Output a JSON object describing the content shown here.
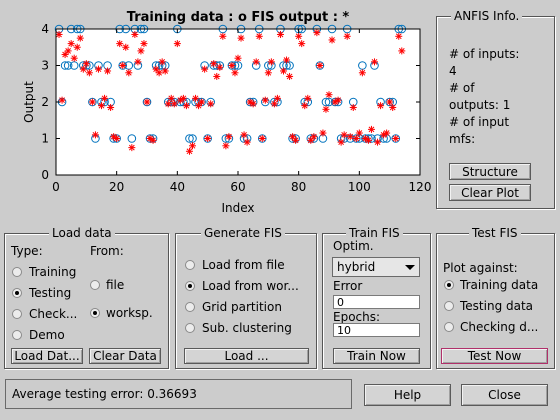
{
  "chart_data": {
    "type": "scatter",
    "title": "Training data : o    FIS output : *",
    "xlabel": "Index",
    "ylabel": "Output",
    "xlim": [
      0,
      120
    ],
    "ylim": [
      0,
      4
    ],
    "xticks": [
      "0",
      "20",
      "40",
      "60",
      "80",
      "100",
      "120"
    ],
    "yticks": [
      "0",
      "1",
      "2",
      "3",
      "4"
    ],
    "grid": false,
    "colors": {
      "training": "#0072bd",
      "fis": "#ff0000"
    },
    "series": [
      {
        "marker": "o",
        "x": [
          1,
          2,
          3,
          4,
          5,
          6,
          7,
          8,
          9,
          10,
          11,
          12,
          13,
          14,
          15,
          16,
          17,
          18,
          19,
          20,
          21,
          22,
          23,
          24,
          25,
          26,
          27,
          28,
          29,
          30,
          31,
          32,
          33,
          34,
          35,
          36,
          37,
          38,
          39,
          40,
          41,
          42,
          43,
          44,
          45,
          46,
          47,
          48,
          49,
          50,
          51,
          52,
          53,
          54,
          55,
          56,
          57,
          58,
          59,
          60,
          61,
          62,
          63,
          64,
          65,
          66,
          67,
          68,
          69,
          70,
          71,
          72,
          73,
          74,
          75,
          76,
          77,
          78,
          79,
          80,
          81,
          82,
          83,
          84,
          85,
          86,
          87,
          88,
          89,
          90,
          91,
          92,
          93,
          94,
          95,
          96,
          97,
          98,
          99,
          100,
          101,
          102,
          103,
          104,
          105,
          106,
          107,
          108,
          109,
          110,
          111,
          112,
          113,
          114
        ],
        "y": [
          4,
          2,
          3,
          3,
          4,
          3,
          4,
          4,
          3,
          3,
          3,
          2,
          1,
          3,
          2,
          2,
          3,
          2,
          1,
          1,
          4,
          3,
          4,
          3,
          1,
          4,
          3,
          4,
          4,
          2,
          1,
          1,
          3,
          3,
          3,
          3,
          2,
          2,
          2,
          4,
          2,
          2,
          2,
          1,
          1,
          2,
          2,
          2,
          3,
          1,
          2,
          3,
          3,
          3,
          4,
          1,
          1,
          3,
          3,
          3,
          4,
          1,
          1,
          2,
          2,
          3,
          4,
          1,
          2,
          3,
          3,
          2,
          2,
          4,
          3,
          3,
          3,
          1,
          1,
          4,
          4,
          2,
          2,
          1,
          1,
          4,
          3,
          1,
          2,
          2,
          4,
          2,
          2,
          1,
          1,
          4,
          1,
          2,
          1,
          1,
          3,
          1,
          1,
          1,
          3,
          1,
          2,
          1,
          1,
          2,
          2,
          1,
          4,
          4
        ]
      },
      {
        "marker": "*",
        "x": [
          1,
          2,
          3,
          4,
          5,
          6,
          7,
          8,
          9,
          10,
          11,
          12,
          13,
          14,
          15,
          16,
          17,
          18,
          19,
          20,
          21,
          22,
          23,
          24,
          25,
          26,
          27,
          28,
          29,
          30,
          31,
          32,
          33,
          34,
          35,
          36,
          37,
          38,
          39,
          40,
          41,
          42,
          43,
          44,
          45,
          46,
          47,
          48,
          49,
          50,
          51,
          52,
          53,
          54,
          55,
          56,
          57,
          58,
          59,
          60,
          61,
          62,
          63,
          64,
          65,
          66,
          67,
          68,
          69,
          70,
          71,
          72,
          73,
          74,
          75,
          76,
          77,
          78,
          79,
          80,
          81,
          82,
          83,
          84,
          85,
          86,
          87,
          88,
          89,
          90,
          91,
          92,
          93,
          94,
          95,
          96,
          97,
          98,
          99,
          100,
          101,
          102,
          103,
          104,
          105,
          106,
          107,
          108,
          109,
          110,
          111,
          112,
          113,
          114
        ],
        "y": [
          3.85,
          2.05,
          3.3,
          3.4,
          3.6,
          3.2,
          3.5,
          3.75,
          2.9,
          3.05,
          2.8,
          2.0,
          1.1,
          2.9,
          1.9,
          2.1,
          2.85,
          1.85,
          1.05,
          1.0,
          3.6,
          3.0,
          3.5,
          2.8,
          0.75,
          3.85,
          3.1,
          3.4,
          3.6,
          2.0,
          1.0,
          0.95,
          2.9,
          2.8,
          3.1,
          2.85,
          1.95,
          2.1,
          1.95,
          3.6,
          2.05,
          2.1,
          1.9,
          0.65,
          0.8,
          2.1,
          1.9,
          2.0,
          2.9,
          1.0,
          1.95,
          3.05,
          2.7,
          2.95,
          3.8,
          0.8,
          1.05,
          3.0,
          2.8,
          3.2,
          3.75,
          1.1,
          0.9,
          2.0,
          1.95,
          3.1,
          3.8,
          1.0,
          2.05,
          2.8,
          3.1,
          1.95,
          2.1,
          3.85,
          2.85,
          3.15,
          2.7,
          1.05,
          0.95,
          3.8,
          3.6,
          1.9,
          2.1,
          0.95,
          1.05,
          3.9,
          3.0,
          1.15,
          1.8,
          2.2,
          3.7,
          2.0,
          2.05,
          0.9,
          1.1,
          3.8,
          1.05,
          1.85,
          1.0,
          1.15,
          2.8,
          1.0,
          0.95,
          1.25,
          3.1,
          0.9,
          1.9,
          1.1,
          1.15,
          2.0,
          1.85,
          1.0,
          3.8,
          3.4
        ]
      }
    ]
  },
  "anfis_info": {
    "title": "ANFIS Info.",
    "lines": [
      "# of inputs:",
      "4",
      "# of",
      "outputs: 1",
      "# of input",
      "mfs:"
    ],
    "structure_label": "Structure",
    "clear_plot_label": "Clear Plot"
  },
  "load_data": {
    "title": "Load data",
    "type_label": "Type:",
    "from_label": "From:",
    "types": [
      {
        "label": "Training",
        "selected": false
      },
      {
        "label": "Testing",
        "selected": true
      },
      {
        "label": "Check...",
        "selected": false
      },
      {
        "label": "Demo",
        "selected": false
      }
    ],
    "sources": [
      {
        "label": "file",
        "selected": false
      },
      {
        "label": "worksp.",
        "selected": true
      }
    ],
    "load_button": "Load Dat...",
    "clear_button": "Clear Data"
  },
  "generate_fis": {
    "title": "Generate FIS",
    "options": [
      {
        "label": "Load from file",
        "selected": false
      },
      {
        "label": "Load from wor...",
        "selected": true
      },
      {
        "label": "Grid partition",
        "selected": false
      },
      {
        "label": "Sub. clustering",
        "selected": false
      }
    ],
    "load_button": "Load ..."
  },
  "train_fis": {
    "title": "Train FIS",
    "optim_label": "Optim.",
    "optim_value": "hybrid",
    "error_label": "Error",
    "error_value": "0",
    "epochs_label": "Epochs:",
    "epochs_value": "10",
    "train_button": "Train Now"
  },
  "test_fis": {
    "title": "Test FIS",
    "plot_against_label": "Plot against:",
    "options": [
      {
        "label": "Training data",
        "selected": true
      },
      {
        "label": "Testing data",
        "selected": false
      },
      {
        "label": "Checking d...",
        "selected": false
      }
    ],
    "test_button": "Test Now"
  },
  "status": {
    "text": "Average testing error: 0.36693"
  },
  "footer": {
    "help_label": "Help",
    "close_label": "Close"
  }
}
